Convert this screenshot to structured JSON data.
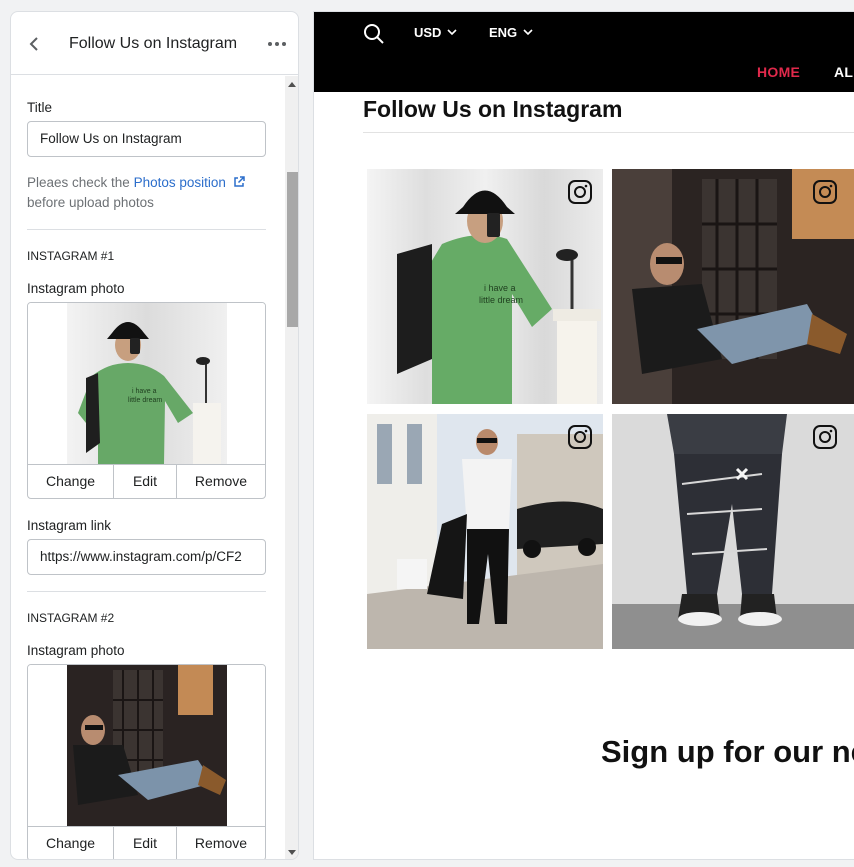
{
  "sidebar": {
    "title": "Follow Us on Instagram",
    "back_icon": "chevron-left-icon",
    "more_icon": "more-horizontal-icon",
    "title_label": "Title",
    "title_value": "Follow  Us on Instagram",
    "note_prefix": "Pleaes check the ",
    "note_link": "Photos position",
    "note_suffix": "before upload photos",
    "blocks": [
      {
        "heading": "INSTAGRAM #1",
        "photo_label": "Instagram photo",
        "buttons": [
          "Change",
          "Edit",
          "Remove"
        ],
        "link_label": "Instagram link",
        "link_value": "https://www.instagram.com/p/CF2"
      },
      {
        "heading": "INSTAGRAM #2",
        "photo_label": "Instagram photo",
        "buttons": [
          "Change",
          "Edit",
          "Remove"
        ]
      }
    ]
  },
  "preview": {
    "currency": "USD",
    "language": "ENG",
    "nav": [
      "HOME",
      "ALL"
    ],
    "nav_active_color": "#e0294b",
    "section_title": "Follow Us on Instagram",
    "signup_text": "Sign up for our ne"
  }
}
